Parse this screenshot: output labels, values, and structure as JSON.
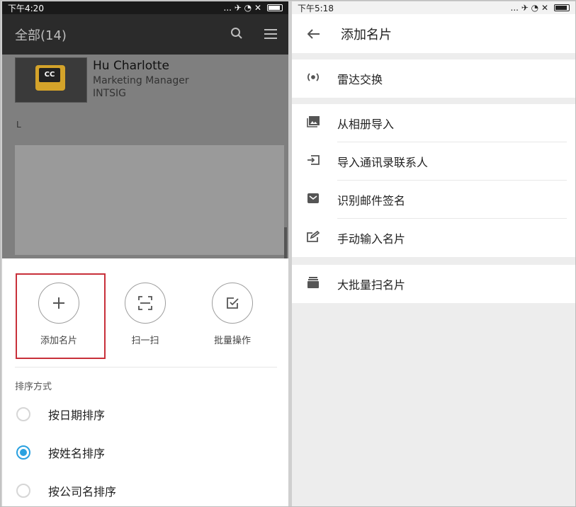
{
  "left_screen": {
    "status": {
      "time": "下午4:20",
      "icons": "... ✈ ◔ ✕"
    },
    "topbar": {
      "title": "全部(14)"
    },
    "card": {
      "name": "Hu Charlotte",
      "title": "Marketing Manager",
      "company": "INTSIG",
      "thumb_text": "CC"
    },
    "section_letter": "L",
    "actions": [
      {
        "label": "添加名片",
        "icon": "plus-icon"
      },
      {
        "label": "扫一扫",
        "icon": "scan-icon"
      },
      {
        "label": "批量操作",
        "icon": "batch-check-icon"
      }
    ],
    "sort": {
      "label": "排序方式",
      "options": [
        {
          "label": "按日期排序",
          "selected": false
        },
        {
          "label": "按姓名排序",
          "selected": true
        },
        {
          "label": "按公司名排序",
          "selected": false
        }
      ]
    }
  },
  "right_screen": {
    "status": {
      "time": "下午5:18",
      "icons": "... ✈ ◔ ✕"
    },
    "topbar": {
      "title": "添加名片"
    },
    "groups": [
      [
        {
          "label": "雷达交换",
          "icon": "radar-icon"
        }
      ],
      [
        {
          "label": "从相册导入",
          "icon": "gallery-icon"
        },
        {
          "label": "导入通讯录联系人",
          "icon": "import-contacts-icon"
        },
        {
          "label": "识别邮件签名",
          "icon": "mail-signature-icon"
        },
        {
          "label": "手动输入名片",
          "icon": "edit-icon"
        }
      ],
      [
        {
          "label": "大批量扫名片",
          "icon": "stack-icon"
        }
      ]
    ]
  },
  "colors": {
    "accent": "#2aa1e0",
    "highlight": "#c8303a"
  }
}
